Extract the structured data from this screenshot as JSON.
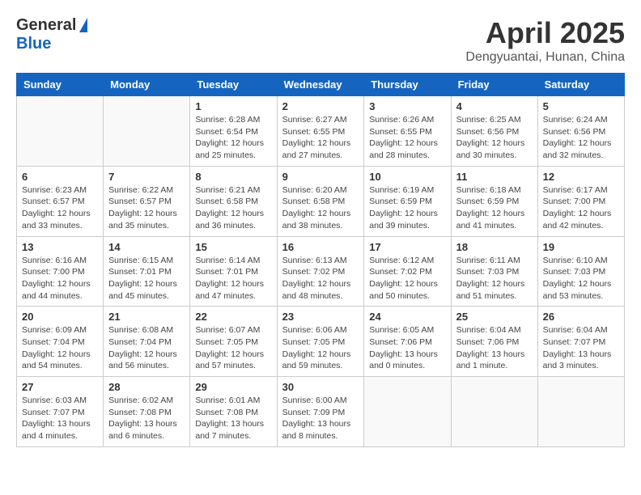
{
  "header": {
    "logo_general": "General",
    "logo_blue": "Blue",
    "month": "April 2025",
    "location": "Dengyuantai, Hunan, China"
  },
  "weekdays": [
    "Sunday",
    "Monday",
    "Tuesday",
    "Wednesday",
    "Thursday",
    "Friday",
    "Saturday"
  ],
  "weeks": [
    [
      {
        "day": "",
        "info": ""
      },
      {
        "day": "",
        "info": ""
      },
      {
        "day": "1",
        "info": "Sunrise: 6:28 AM\nSunset: 6:54 PM\nDaylight: 12 hours and 25 minutes."
      },
      {
        "day": "2",
        "info": "Sunrise: 6:27 AM\nSunset: 6:55 PM\nDaylight: 12 hours and 27 minutes."
      },
      {
        "day": "3",
        "info": "Sunrise: 6:26 AM\nSunset: 6:55 PM\nDaylight: 12 hours and 28 minutes."
      },
      {
        "day": "4",
        "info": "Sunrise: 6:25 AM\nSunset: 6:56 PM\nDaylight: 12 hours and 30 minutes."
      },
      {
        "day": "5",
        "info": "Sunrise: 6:24 AM\nSunset: 6:56 PM\nDaylight: 12 hours and 32 minutes."
      }
    ],
    [
      {
        "day": "6",
        "info": "Sunrise: 6:23 AM\nSunset: 6:57 PM\nDaylight: 12 hours and 33 minutes."
      },
      {
        "day": "7",
        "info": "Sunrise: 6:22 AM\nSunset: 6:57 PM\nDaylight: 12 hours and 35 minutes."
      },
      {
        "day": "8",
        "info": "Sunrise: 6:21 AM\nSunset: 6:58 PM\nDaylight: 12 hours and 36 minutes."
      },
      {
        "day": "9",
        "info": "Sunrise: 6:20 AM\nSunset: 6:58 PM\nDaylight: 12 hours and 38 minutes."
      },
      {
        "day": "10",
        "info": "Sunrise: 6:19 AM\nSunset: 6:59 PM\nDaylight: 12 hours and 39 minutes."
      },
      {
        "day": "11",
        "info": "Sunrise: 6:18 AM\nSunset: 6:59 PM\nDaylight: 12 hours and 41 minutes."
      },
      {
        "day": "12",
        "info": "Sunrise: 6:17 AM\nSunset: 7:00 PM\nDaylight: 12 hours and 42 minutes."
      }
    ],
    [
      {
        "day": "13",
        "info": "Sunrise: 6:16 AM\nSunset: 7:00 PM\nDaylight: 12 hours and 44 minutes."
      },
      {
        "day": "14",
        "info": "Sunrise: 6:15 AM\nSunset: 7:01 PM\nDaylight: 12 hours and 45 minutes."
      },
      {
        "day": "15",
        "info": "Sunrise: 6:14 AM\nSunset: 7:01 PM\nDaylight: 12 hours and 47 minutes."
      },
      {
        "day": "16",
        "info": "Sunrise: 6:13 AM\nSunset: 7:02 PM\nDaylight: 12 hours and 48 minutes."
      },
      {
        "day": "17",
        "info": "Sunrise: 6:12 AM\nSunset: 7:02 PM\nDaylight: 12 hours and 50 minutes."
      },
      {
        "day": "18",
        "info": "Sunrise: 6:11 AM\nSunset: 7:03 PM\nDaylight: 12 hours and 51 minutes."
      },
      {
        "day": "19",
        "info": "Sunrise: 6:10 AM\nSunset: 7:03 PM\nDaylight: 12 hours and 53 minutes."
      }
    ],
    [
      {
        "day": "20",
        "info": "Sunrise: 6:09 AM\nSunset: 7:04 PM\nDaylight: 12 hours and 54 minutes."
      },
      {
        "day": "21",
        "info": "Sunrise: 6:08 AM\nSunset: 7:04 PM\nDaylight: 12 hours and 56 minutes."
      },
      {
        "day": "22",
        "info": "Sunrise: 6:07 AM\nSunset: 7:05 PM\nDaylight: 12 hours and 57 minutes."
      },
      {
        "day": "23",
        "info": "Sunrise: 6:06 AM\nSunset: 7:05 PM\nDaylight: 12 hours and 59 minutes."
      },
      {
        "day": "24",
        "info": "Sunrise: 6:05 AM\nSunset: 7:06 PM\nDaylight: 13 hours and 0 minutes."
      },
      {
        "day": "25",
        "info": "Sunrise: 6:04 AM\nSunset: 7:06 PM\nDaylight: 13 hours and 1 minute."
      },
      {
        "day": "26",
        "info": "Sunrise: 6:04 AM\nSunset: 7:07 PM\nDaylight: 13 hours and 3 minutes."
      }
    ],
    [
      {
        "day": "27",
        "info": "Sunrise: 6:03 AM\nSunset: 7:07 PM\nDaylight: 13 hours and 4 minutes."
      },
      {
        "day": "28",
        "info": "Sunrise: 6:02 AM\nSunset: 7:08 PM\nDaylight: 13 hours and 6 minutes."
      },
      {
        "day": "29",
        "info": "Sunrise: 6:01 AM\nSunset: 7:08 PM\nDaylight: 13 hours and 7 minutes."
      },
      {
        "day": "30",
        "info": "Sunrise: 6:00 AM\nSunset: 7:09 PM\nDaylight: 13 hours and 8 minutes."
      },
      {
        "day": "",
        "info": ""
      },
      {
        "day": "",
        "info": ""
      },
      {
        "day": "",
        "info": ""
      }
    ]
  ]
}
